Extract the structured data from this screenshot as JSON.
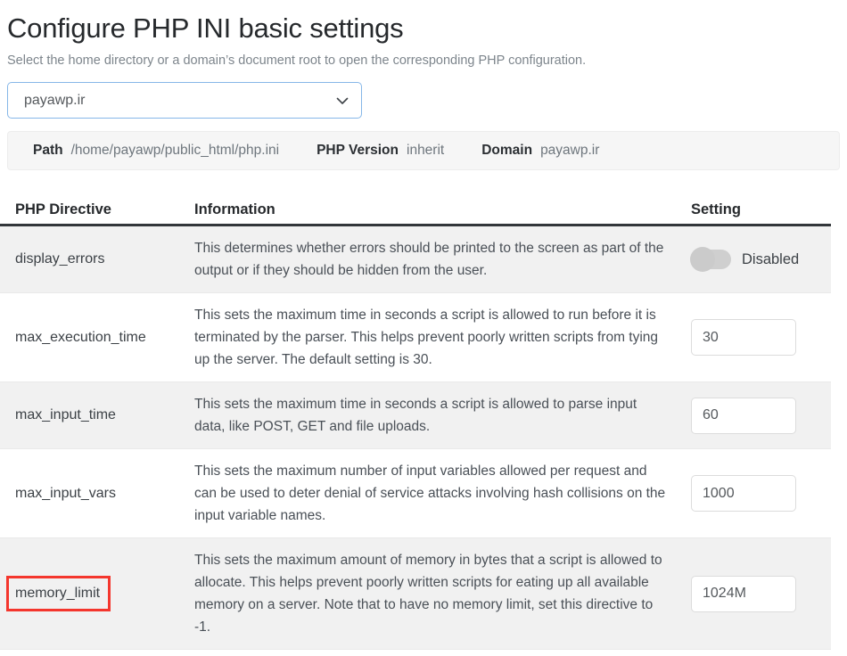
{
  "header": {
    "title": "Configure PHP INI basic settings",
    "subtitle": "Select the home directory or a domain’s document root to open the corresponding PHP configuration."
  },
  "domain_select": {
    "selected": "payawp.ir",
    "options": [
      "payawp.ir"
    ],
    "chevron_icon": "chevron-down-icon",
    "border_color": "#86b7e8"
  },
  "info_bar": {
    "path_label": "Path",
    "path_value": "/home/payawp/public_html/php.ini",
    "php_version_label": "PHP Version",
    "php_version_value": "inherit",
    "domain_label": "Domain",
    "domain_value": "payawp.ir"
  },
  "table": {
    "columns": {
      "directive": "PHP Directive",
      "information": "Information",
      "setting": "Setting"
    },
    "rows": [
      {
        "directive": "display_errors",
        "information": "This determines whether errors should be printed to the screen as part of the output or if they should be hidden from the user.",
        "control": "toggle",
        "toggle_state": "off",
        "toggle_label": "Disabled"
      },
      {
        "directive": "max_execution_time",
        "information": "This sets the maximum time in seconds a script is allowed to run before it is terminated by the parser. This helps prevent poorly written scripts from tying up the server. The default setting is 30.",
        "control": "input",
        "value": "30"
      },
      {
        "directive": "max_input_time",
        "information": "This sets the maximum time in seconds a script is allowed to parse input data, like POST, GET and file uploads.",
        "control": "input",
        "value": "60"
      },
      {
        "directive": "max_input_vars",
        "information": "This sets the maximum number of input variables allowed per request and can be used to deter denial of service attacks involving hash collisions on the input variable names.",
        "control": "input",
        "value": "1000"
      },
      {
        "directive": "memory_limit",
        "information": "This sets the maximum amount of memory in bytes that a script is allowed to allocate. This helps prevent poorly written scripts for eating up all available memory on a server. Note that to have no memory limit, set this directive to -1.",
        "control": "input",
        "value": "1024M",
        "highlighted": true,
        "highlight_color": "#f4362d"
      }
    ]
  }
}
